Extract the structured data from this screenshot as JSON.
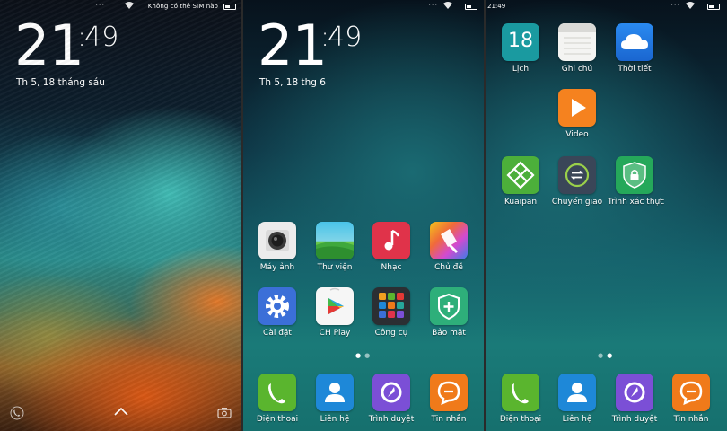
{
  "lock": {
    "status": {
      "carrier": "Không có thẻ SIM nào"
    },
    "clock_h": "21",
    "clock_m": "49",
    "date": "Th 5, 18 tháng sáu",
    "icons": {
      "left": "phone-icon",
      "center": "chevron-up-icon",
      "right": "camera-icon"
    }
  },
  "home1": {
    "clock_h": "21",
    "clock_m": "49",
    "date": "Th 5, 18 thg 6",
    "apps": [
      {
        "label": "Máy ảnh",
        "icon": "camera-icon"
      },
      {
        "label": "Thư viện",
        "icon": "gallery-icon"
      },
      {
        "label": "Nhạc",
        "icon": "music-icon"
      },
      {
        "label": "Chủ đề",
        "icon": "themes-icon"
      },
      {
        "label": "Cài đặt",
        "icon": "settings-gear-icon"
      },
      {
        "label": "CH Play",
        "icon": "play-store-icon"
      },
      {
        "label": "Công cụ",
        "icon": "tools-folder-icon"
      },
      {
        "label": "Bảo mật",
        "icon": "security-shield-icon"
      }
    ],
    "dock": [
      {
        "label": "Điện thoại",
        "icon": "phone-icon"
      },
      {
        "label": "Liên hệ",
        "icon": "contacts-icon"
      },
      {
        "label": "Trình duyệt",
        "icon": "browser-icon"
      },
      {
        "label": "Tin nhắn",
        "icon": "messages-icon"
      }
    ],
    "page_indicator": {
      "pages": 2,
      "current": 1
    }
  },
  "home2": {
    "status": {
      "time": "21:49"
    },
    "apps": [
      {
        "label": "Lịch",
        "icon": "calendar-icon",
        "number": "18"
      },
      {
        "label": "Ghi chú",
        "icon": "notes-icon"
      },
      {
        "label": "Thời tiết",
        "icon": "weather-icon"
      },
      {
        "label": "Video",
        "icon": "video-play-icon"
      },
      {
        "label": "Kuaipan",
        "icon": "kuaipan-icon"
      },
      {
        "label": "Chuyển giao",
        "icon": "transfer-icon"
      },
      {
        "label": "Trình xác thực",
        "icon": "authenticator-shield-icon"
      }
    ],
    "dock": [
      {
        "label": "Điện thoại",
        "icon": "phone-icon"
      },
      {
        "label": "Liên hệ",
        "icon": "contacts-icon"
      },
      {
        "label": "Trình duyệt",
        "icon": "browser-icon"
      },
      {
        "label": "Tin nhắn",
        "icon": "messages-icon"
      }
    ],
    "page_indicator": {
      "pages": 2,
      "current": 2
    }
  },
  "colors": {
    "phone": "#5ab52e",
    "contacts": "#1e88d8",
    "browser": "#7b4fd6",
    "messages": "#f07a1a",
    "camera": "#e9e9e9",
    "music": "#e0334a",
    "settings": "#3b6fd8",
    "security": "#2eaf7a",
    "calendar": "#1a9aa0",
    "weather": "#1e78e0",
    "video": "#f5821f",
    "kuaipan": "#4caf3a",
    "transfer": "#3a4658",
    "authenticator": "#25a85a"
  }
}
